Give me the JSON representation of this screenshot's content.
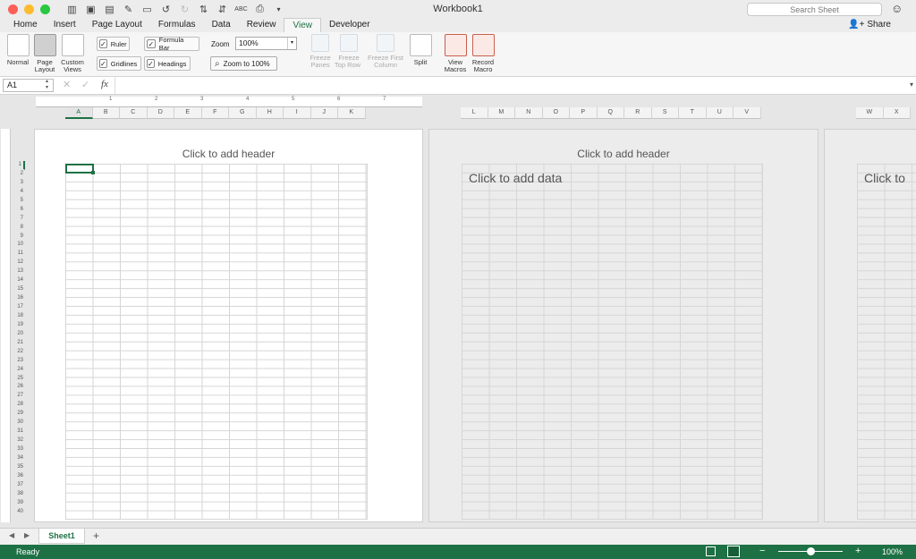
{
  "window": {
    "title": "Workbook1"
  },
  "search": {
    "placeholder": "Search Sheet"
  },
  "tabs": [
    "Home",
    "Insert",
    "Page Layout",
    "Formulas",
    "Data",
    "Review",
    "View",
    "Developer"
  ],
  "active_tab": "View",
  "share_label": "Share",
  "ribbon": {
    "views": [
      {
        "label1": "Normal",
        "label2": ""
      },
      {
        "label1": "Page",
        "label2": "Layout"
      },
      {
        "label1": "Custom",
        "label2": "Views"
      }
    ],
    "ruler": "Ruler",
    "formula_bar": "Formula Bar",
    "gridlines": "Gridlines",
    "headings": "Headings",
    "zoom_label": "Zoom",
    "zoom_value": "100%",
    "zoom_to_100": "Zoom to 100%",
    "freeze_panes_1": "Freeze",
    "freeze_panes_2": "Panes",
    "freeze_top_1": "Freeze",
    "freeze_top_2": "Top Row",
    "freeze_first_1": "Freeze First",
    "freeze_first_2": "Column",
    "split": "Split",
    "view_macros_1": "View",
    "view_macros_2": "Macros",
    "record_macro_1": "Record",
    "record_macro_2": "Macro"
  },
  "formula_bar": {
    "name_box": "A1",
    "fx": "fx",
    "cancel": "✕",
    "confirm": "✓"
  },
  "ruler_marks": [
    "1",
    "2",
    "3",
    "4",
    "5",
    "6",
    "7"
  ],
  "columns_page1": [
    "A",
    "B",
    "C",
    "D",
    "E",
    "F",
    "G",
    "H",
    "I",
    "J",
    "K"
  ],
  "columns_page2": [
    "L",
    "M",
    "N",
    "O",
    "P",
    "Q",
    "R",
    "S",
    "T",
    "U",
    "V"
  ],
  "columns_page3": [
    "W",
    "X"
  ],
  "rows": [
    "1",
    "2",
    "3",
    "4",
    "5",
    "6",
    "7",
    "8",
    "9",
    "10",
    "11",
    "12",
    "13",
    "14",
    "15",
    "16",
    "17",
    "18",
    "19",
    "20",
    "21",
    "22",
    "23",
    "24",
    "25",
    "26",
    "27",
    "28",
    "29",
    "30",
    "31",
    "32",
    "33",
    "34",
    "35",
    "36",
    "37",
    "38",
    "39",
    "40"
  ],
  "pages": {
    "header_placeholder": "Click to add header",
    "data_placeholder": "Click to add data",
    "data_placeholder_cut": "Click to"
  },
  "sheet_tabs": [
    "Sheet1"
  ],
  "status": {
    "ready": "Ready",
    "zoom": "100%",
    "zoom_fraction": 0.5
  },
  "colors": {
    "accent": "#1e7145",
    "close": "#fc5f57",
    "minimize": "#fdbc2e",
    "maximize": "#28c840"
  }
}
